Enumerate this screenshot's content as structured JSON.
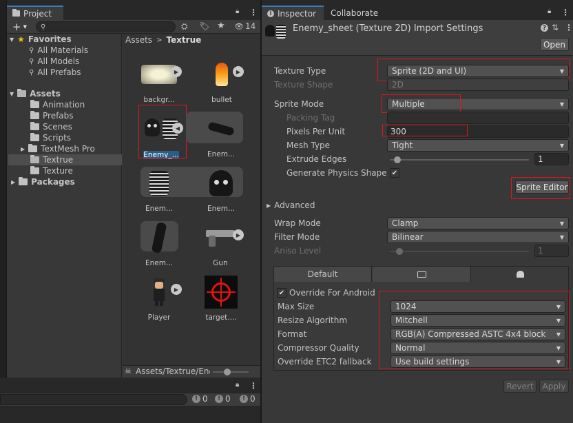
{
  "project": {
    "tab_label": "Project",
    "add_label": "+",
    "hidden_count": "14",
    "favorites": {
      "label": "Favorites",
      "items": [
        "All Materials",
        "All Models",
        "All Prefabs"
      ]
    },
    "assets": {
      "label": "Assets",
      "items": [
        "Animation",
        "Prefabs",
        "Scenes",
        "Scripts",
        "TextMesh Pro",
        "Textrue",
        "Texture"
      ]
    },
    "packages_label": "Packages",
    "breadcrumb": {
      "root": "Assets",
      "current": "Textrue"
    },
    "grid": [
      {
        "label": "backgr...",
        "icon": "background-texture-icon"
      },
      {
        "label": "bullet",
        "icon": "bullet-sprite-icon"
      },
      {
        "label": "Enemy_...",
        "icon": "enemy-sheet-icon"
      },
      {
        "label": "Enem...",
        "icon": "enemy-arm-sprite-icon"
      },
      {
        "label": "Enem...",
        "icon": "enemy-ribcage-skull-icon"
      },
      {
        "label": "Enem...",
        "icon": "enemy-leg-sprite-icon"
      },
      {
        "label": "Gun",
        "icon": "gun-sprite-icon"
      },
      {
        "label": "Player",
        "icon": "player-sprite-icon"
      },
      {
        "label": "target....",
        "icon": "target-crosshair-icon"
      }
    ],
    "path": "Assets/Textrue/Ene",
    "console": {
      "errors": "0",
      "warnings": "0",
      "messages": "0"
    }
  },
  "inspector": {
    "tabs": [
      "Inspector",
      "Collaborate"
    ],
    "title": "Enemy_sheet (Texture 2D) Import Settings",
    "open_label": "Open",
    "texture_type": {
      "label": "Texture Type",
      "value": "Sprite (2D and UI)"
    },
    "texture_shape": {
      "label": "Texture Shape",
      "value": "2D"
    },
    "sprite_mode": {
      "label": "Sprite Mode",
      "value": "Multiple"
    },
    "packing_tag": {
      "label": "Packing Tag",
      "value": ""
    },
    "pixels_per_unit": {
      "label": "Pixels Per Unit",
      "value": "300"
    },
    "mesh_type": {
      "label": "Mesh Type",
      "value": "Tight"
    },
    "extrude_edges": {
      "label": "Extrude Edges",
      "value": "1"
    },
    "generate_physics": {
      "label": "Generate Physics Shape",
      "checked": true
    },
    "sprite_editor_label": "Sprite Editor",
    "advanced_label": "Advanced",
    "wrap_mode": {
      "label": "Wrap Mode",
      "value": "Clamp"
    },
    "filter_mode": {
      "label": "Filter Mode",
      "value": "Bilinear"
    },
    "aniso_level": {
      "label": "Aniso Level",
      "value": "1"
    },
    "platform_tabs": {
      "default": "Default"
    },
    "override_android": {
      "label": "Override For Android",
      "checked": true
    },
    "max_size": {
      "label": "Max Size",
      "value": "1024"
    },
    "resize_algorithm": {
      "label": "Resize Algorithm",
      "value": "Mitchell"
    },
    "format": {
      "label": "Format",
      "value": "RGB(A) Compressed ASTC 4x4 block"
    },
    "compressor_quality": {
      "label": "Compressor Quality",
      "value": "Normal"
    },
    "override_etc2": {
      "label": "Override ETC2 fallback",
      "value": "Use build settings"
    },
    "revert_label": "Revert",
    "apply_label": "Apply"
  },
  "colors": {
    "highlight": "#e0161b",
    "selection": "#2c5d87",
    "accent": "#3a79bb"
  }
}
